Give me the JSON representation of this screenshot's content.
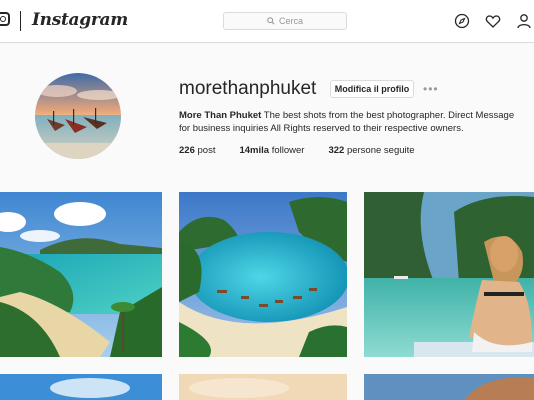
{
  "app": {
    "wordmark": "Instagram",
    "search_placeholder": "Cerca"
  },
  "profile": {
    "username": "morethanphuket",
    "edit_label": "Modifica il profilo",
    "more_label": "•••",
    "display_name": "More Than Phuket",
    "bio_text": " The best shots from the best photographer.  Direct Message for business inquiries All Rights reserved to their respective owners.",
    "stats": [
      {
        "value": "226",
        "label": "post"
      },
      {
        "value": "14mila",
        "label": "follower"
      },
      {
        "value": "322",
        "label": "persone seguite"
      }
    ]
  },
  "colors": {
    "border": "#dbdbdb",
    "text": "#262626",
    "muted": "#999999"
  }
}
